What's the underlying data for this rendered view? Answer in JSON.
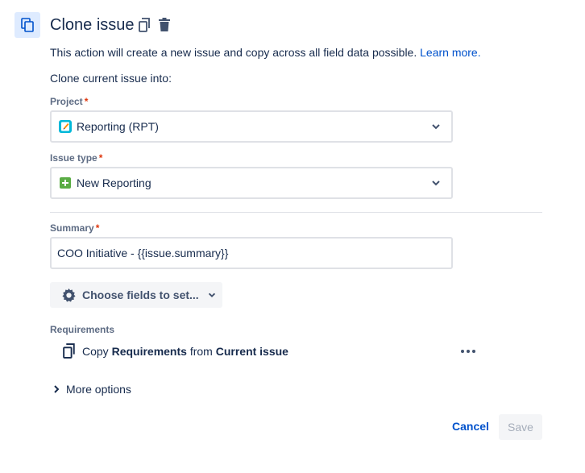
{
  "header": {
    "title": "Clone issue",
    "icon": "clone-icon",
    "actions": [
      {
        "icon": "copy-icon"
      },
      {
        "icon": "trash-icon"
      }
    ]
  },
  "description": {
    "text": "This action will create a new issue and copy across all field data possible.",
    "link": "Learn more."
  },
  "subtitle": "Clone current issue into:",
  "project": {
    "label": "Project",
    "required_marker": "*",
    "value": "Reporting (RPT)",
    "icon": "project-icon",
    "icon_color": "#00b8d9"
  },
  "issue_type": {
    "label": "Issue type",
    "required_marker": "*",
    "value": "New Reporting",
    "icon": "plus-square-icon",
    "icon_color": "#5aac44"
  },
  "summary": {
    "label": "Summary",
    "required_marker": "*",
    "value": "COO Initiative - {{issue.summary}}"
  },
  "choose_fields": {
    "label": "Choose fields to set..."
  },
  "requirements": {
    "label": "Requirements",
    "prefix": "Copy",
    "field": "Requirements",
    "middle": "from",
    "source": "Current issue"
  },
  "more_options": "More options",
  "footer": {
    "cancel": "Cancel",
    "save": "Save"
  },
  "colors": {
    "link": "#0052cc",
    "required": "#de350b",
    "text": "#172b4d"
  }
}
